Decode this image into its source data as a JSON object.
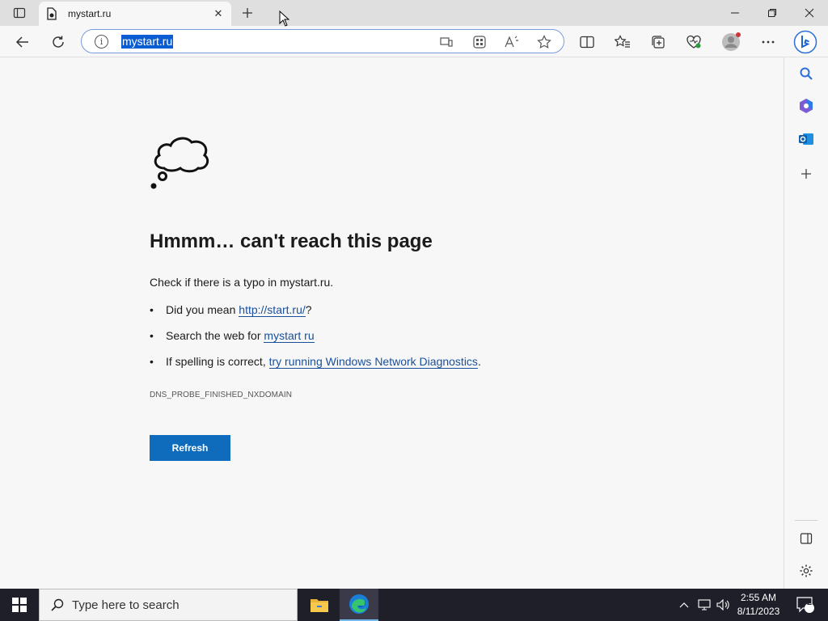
{
  "browser": {
    "tab_title": "mystart.ru",
    "address": "mystart.ru"
  },
  "page": {
    "heading": "Hmmm… can't reach this page",
    "check_text": "Check if there is a typo in mystart.ru.",
    "bullets": [
      {
        "prefix": "Did you mean ",
        "link": "http://start.ru/",
        "suffix": "?"
      },
      {
        "prefix": "Search the web for ",
        "link": "mystart ru",
        "suffix": ""
      },
      {
        "prefix": "If spelling is correct, ",
        "link": "try running Windows Network Diagnostics",
        "suffix": "."
      }
    ],
    "error_code": "DNS_PROBE_FINISHED_NXDOMAIN",
    "refresh_label": "Refresh"
  },
  "taskbar": {
    "search_placeholder": "Type here to search",
    "time": "2:55 AM",
    "date": "8/11/2023",
    "notification_count": "2"
  },
  "colors": {
    "accent": "#0f6cbd",
    "link": "#1a4f9c",
    "address_highlight": "#0a5dd2",
    "taskbar": "#1f1f2a"
  }
}
